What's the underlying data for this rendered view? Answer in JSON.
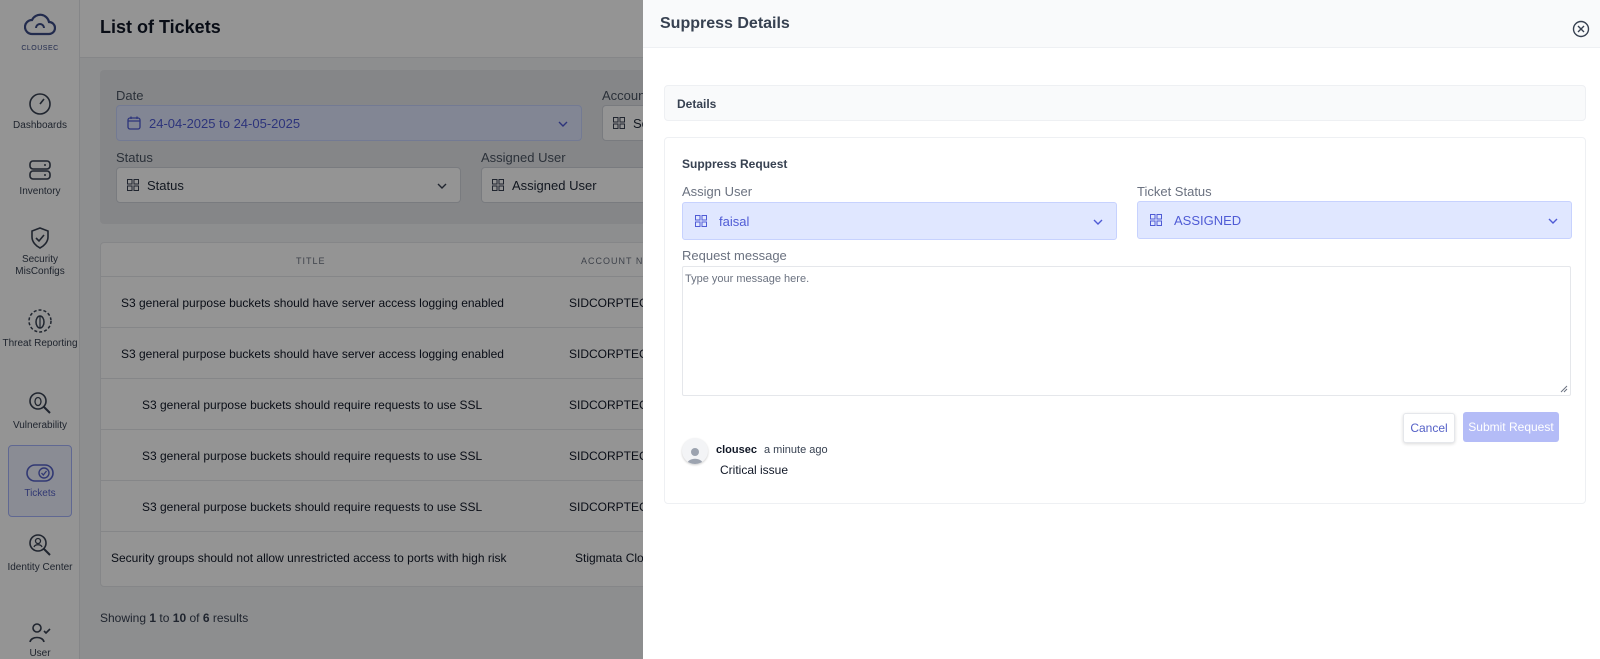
{
  "brand": {
    "logo_text": "CLOUSEC"
  },
  "sidebar": {
    "items": [
      {
        "label": "Dashboards",
        "icon": "gauge-icon"
      },
      {
        "label": "Inventory",
        "icon": "server-icon"
      },
      {
        "label": "Security MisConfigs",
        "icon": "shield-check-icon"
      },
      {
        "label": "Threat Reporting",
        "icon": "bug-icon"
      },
      {
        "label": "Vulnerability",
        "icon": "magnifier-bug-icon"
      },
      {
        "label": "Tickets",
        "icon": "ticket-icon",
        "active": true
      },
      {
        "label": "Identity Center",
        "icon": "identity-search-icon"
      },
      {
        "label": "User",
        "icon": "user-check-icon"
      }
    ]
  },
  "header": {
    "title": "List of Tickets"
  },
  "filters": {
    "date_label": "Date",
    "date_value": "24-04-2025 to 24-05-2025",
    "account_label": "Accoun",
    "account_value": "Se",
    "status_label": "Status",
    "status_value": "Status",
    "assigned_label": "Assigned User",
    "assigned_value": "Assigned User"
  },
  "table": {
    "columns": [
      "TITLE",
      "ACCOUNT NA"
    ],
    "rows": [
      {
        "title": "S3 general purpose buckets should have server access logging enabled",
        "account": "SIDCORPTECH"
      },
      {
        "title": "S3 general purpose buckets should have server access logging enabled",
        "account": "SIDCORPTECH"
      },
      {
        "title": "S3 general purpose buckets should require requests to use SSL",
        "account": "SIDCORPTECH"
      },
      {
        "title": "S3 general purpose buckets should require requests to use SSL",
        "account": "SIDCORPTECH"
      },
      {
        "title": "S3 general purpose buckets should require requests to use SSL",
        "account": "SIDCORPTECH"
      },
      {
        "title": "Security groups should not allow unrestricted access to ports with high risk",
        "account": "Stigmata Clo"
      }
    ]
  },
  "pagination": {
    "prefix": "Showing",
    "from": "1",
    "to_word": "to",
    "to": "10",
    "of_word": "of",
    "total": "6",
    "suffix": "results"
  },
  "drawer": {
    "title": "Suppress Details",
    "details_heading": "Details",
    "section_title": "Suppress Request",
    "assign_user_label": "Assign User",
    "assign_user_value": "faisal",
    "ticket_status_label": "Ticket Status",
    "ticket_status_value": "ASSIGNED",
    "request_message_label": "Request message",
    "request_message_placeholder": "Type your message here.",
    "cancel_label": "Cancel",
    "submit_label": "Submit Request",
    "comment": {
      "user": "clousec",
      "time": "a minute ago",
      "text": "Critical issue"
    }
  },
  "colors": {
    "accent": "#4f5bd5",
    "select_bg": "#e0e7ff",
    "submit_bg": "#b4bcf7",
    "overlay": "rgba(0,0,0,0.42)"
  }
}
